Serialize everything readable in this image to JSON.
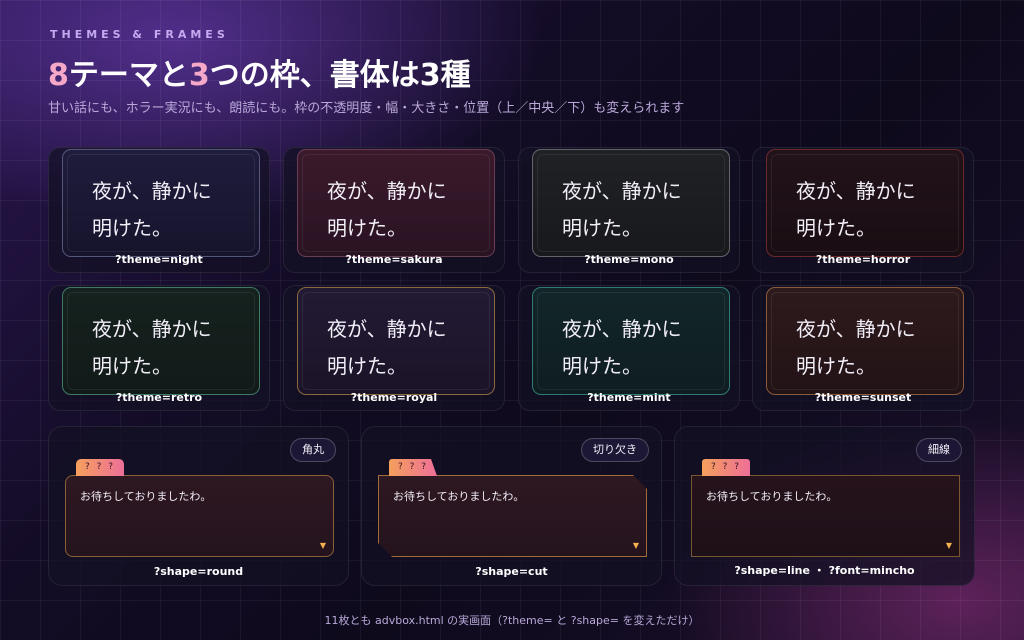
{
  "header": {
    "eyebrow": "THEMES & FRAMES",
    "title_parts": [
      "8",
      "テーマと",
      "3",
      "つの枠、書体は3種"
    ],
    "subtitle": "甘い話にも、ホラー実況にも、朗読にも。枠の不透明度・幅・大きさ・位置（上／中央／下）も変えられます"
  },
  "sample_text": {
    "line1": "夜が、静かに",
    "line2": "明けた。"
  },
  "themes": [
    {
      "param": "?theme=night"
    },
    {
      "param": "?theme=sakura"
    },
    {
      "param": "?theme=mono"
    },
    {
      "param": "?theme=horror"
    },
    {
      "param": "?theme=retro"
    },
    {
      "param": "?theme=royal"
    },
    {
      "param": "?theme=mint"
    },
    {
      "param": "?theme=sunset"
    }
  ],
  "shapes": [
    {
      "badge": "角丸",
      "name_tag": "? ? ?",
      "message": "お待ちしておりましたわ。",
      "caption": "?shape=round",
      "arrow": "▼"
    },
    {
      "badge": "切り欠き",
      "name_tag": "? ? ?",
      "message": "お待ちしておりましたわ。",
      "caption": "?shape=cut",
      "arrow": "▼"
    },
    {
      "badge": "細線",
      "name_tag": "? ? ?",
      "message": "お待ちしておりましたわ。",
      "caption": "?shape=line ・ ?font=mincho",
      "arrow": "▼"
    }
  ],
  "footer": "11枚とも advbox.html の実画面（?theme= と ?shape= を変えただけ）",
  "colors": {
    "accent_pink": "#f6a8c8",
    "name_tag_gradient": [
      "#f4a05c",
      "#ee6f98"
    ],
    "arrow": "#f5b04f"
  }
}
